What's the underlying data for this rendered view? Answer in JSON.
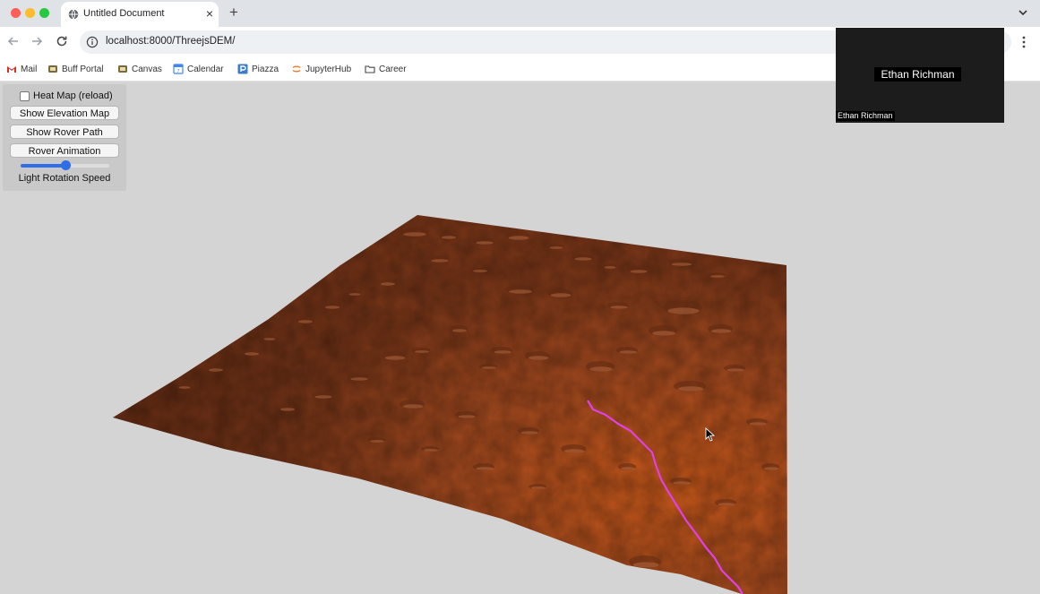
{
  "browser": {
    "tab": {
      "title": "Untitled Document",
      "close_glyph": "×",
      "favicon": "globe-icon"
    },
    "new_tab_glyph": "+",
    "url": "localhost:8000/ThreejsDEM/",
    "bookmarks": [
      {
        "label": "Mail",
        "icon": "gmail-icon"
      },
      {
        "label": "Buff Portal",
        "icon": "buff-portal-icon"
      },
      {
        "label": "Canvas",
        "icon": "canvas-icon"
      },
      {
        "label": "Calendar",
        "icon": "calendar-icon"
      },
      {
        "label": "Piazza",
        "icon": "piazza-icon"
      },
      {
        "label": "JupyterHub",
        "icon": "jupyter-icon"
      },
      {
        "label": "Career",
        "icon": "folder-icon"
      }
    ]
  },
  "controls": {
    "heatmap_label": "Heat Map (reload)",
    "heatmap_checked": false,
    "elevation_button": "Show Elevation Map",
    "rover_path_button": "Show Rover Path",
    "rover_animation_button": "Rover Animation",
    "light_speed_label": "Light Rotation Speed",
    "light_speed_value": 0.5
  },
  "video": {
    "participant_name": "Ethan Richman",
    "caption_name": "Ethan Richman"
  },
  "colors": {
    "terrain": "#b4521f",
    "rover_path": "#e040e8",
    "slider_accent": "#2f6ee8",
    "viewport_bg": "#d4d4d4"
  }
}
